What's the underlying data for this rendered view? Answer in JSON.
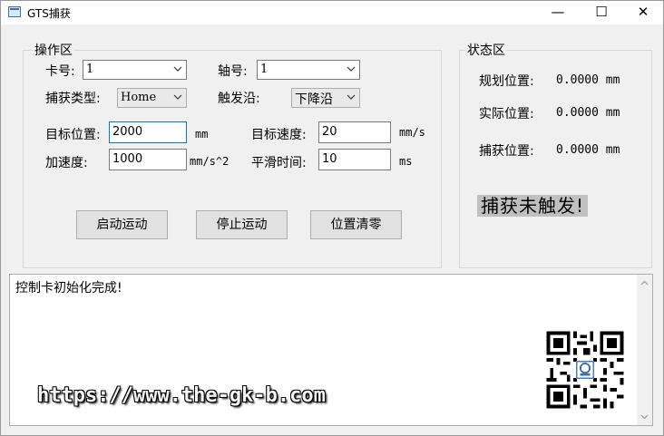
{
  "window": {
    "title": "GTS捕获",
    "minimize_glyph": "—",
    "maximize_glyph": "☐",
    "close_glyph": "✕"
  },
  "operation_group": {
    "title": "操作区",
    "card_label": "卡号:",
    "card_value": "1",
    "axis_label": "轴号:",
    "axis_value": "1",
    "capture_type_label": "捕获类型:",
    "capture_type_value": "Home",
    "trigger_edge_label": "触发沿:",
    "trigger_edge_value": "下降沿",
    "target_pos_label": "目标位置:",
    "target_pos_value": "2000",
    "target_pos_unit": "mm",
    "target_speed_label": "目标速度:",
    "target_speed_value": "20",
    "target_speed_unit": "mm/s",
    "accel_label": "加速度:",
    "accel_value": "1000",
    "accel_unit": "mm/s^2",
    "smooth_time_label": "平滑时间:",
    "smooth_time_value": "10",
    "smooth_time_unit": "ms",
    "start_button": "启动运动",
    "stop_button": "停止运动",
    "zero_button": "位置清零"
  },
  "status_group": {
    "title": "状态区",
    "planned_label": "规划位置:",
    "planned_value": "0.0000 mm",
    "actual_label": "实际位置:",
    "actual_value": "0.0000 mm",
    "capture_label": "捕获位置:",
    "capture_value": "0.0000 mm",
    "trigger_status": "捕获未触发!"
  },
  "log": {
    "text": "控制卡初始化完成!"
  },
  "watermark": {
    "url": "https://www.the-gk-b.com"
  },
  "icons": {
    "app": "window-app-icon",
    "dropdown": "chevron-down-icon",
    "scroll_up": "scroll-up-arrow-icon",
    "scroll_down": "scroll-down-arrow-icon",
    "qr": "qr-code-image"
  }
}
